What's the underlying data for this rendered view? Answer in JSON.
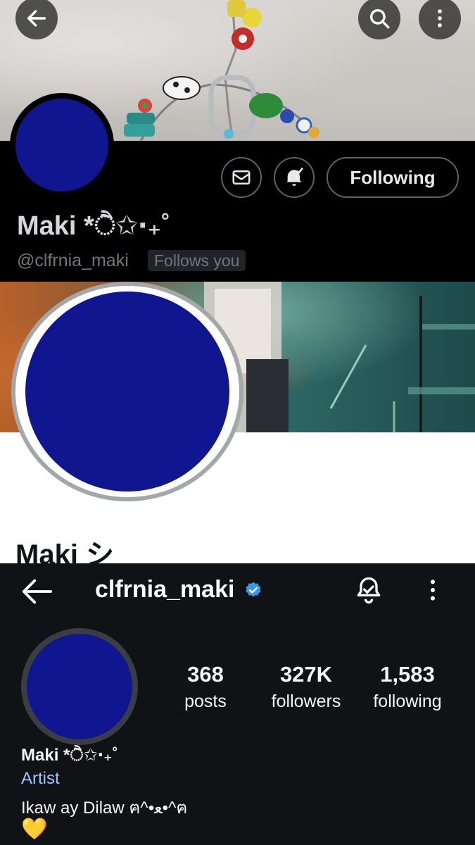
{
  "x_profile": {
    "name": "Maki *ੈ✩‧₊˚",
    "handle": "@clfrnia_maki",
    "follows_badge": "Follows you",
    "following_label": "Following",
    "icons": [
      "back-arrow-icon",
      "search-icon",
      "more-vertical-icon",
      "mail-icon",
      "bell-check-icon"
    ],
    "colors": {
      "background": "#000000",
      "avatar": "#0f1690"
    }
  },
  "light_profile": {
    "name": "Maki シ",
    "colors": {
      "background": "#ffffff",
      "avatar": "#0f1690"
    }
  },
  "ig_profile": {
    "username": "clfrnia_maki",
    "stats": [
      {
        "value": "368",
        "label": "posts"
      },
      {
        "value": "327K",
        "label": "followers"
      },
      {
        "value": "1,583",
        "label": "following"
      }
    ],
    "bio_name": "Maki *ੈ✩‧₊˚",
    "category": "Artist",
    "bio_text": "Ikaw ay Dilaw  ฅ^•ﻌ•^ฅ",
    "bio_emoji": "💛",
    "icons": [
      "back-arrow-icon",
      "verified-badge-icon",
      "bell-icon",
      "more-vertical-icon"
    ],
    "colors": {
      "background": "#101216",
      "verified": "#3797f0",
      "category": "#9fc3ff"
    }
  }
}
